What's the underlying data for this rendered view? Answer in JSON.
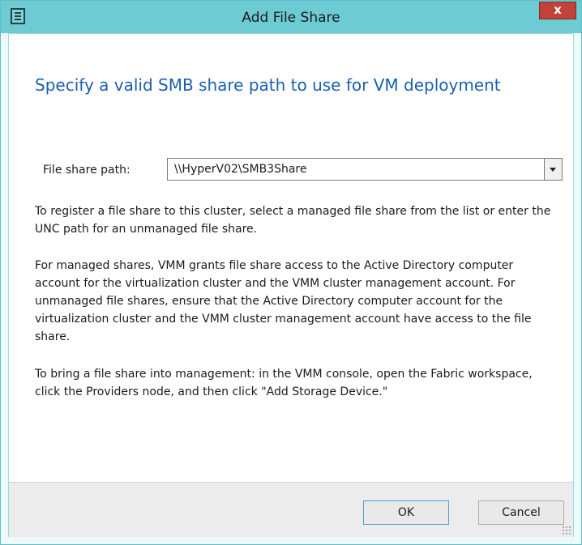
{
  "window": {
    "title": "Add File Share",
    "close_glyph": "x"
  },
  "dialog": {
    "heading": "Specify a valid SMB share path to use for VM deployment",
    "file_share_label": "File share path:",
    "file_share_value": "\\\\HyperV02\\SMB3Share",
    "paragraph1": "To register a file share to this cluster, select a managed file share from the list or enter the UNC path for an unmanaged file share.",
    "paragraph2": "For managed shares, VMM grants file share access to the Active Directory computer account for the virtualization cluster and the VMM cluster management account. For unmanaged file shares, ensure that the Active Directory computer account for the virtualization cluster and the VMM cluster management account have access to the file share.",
    "paragraph3": "To bring a file share into management: in the VMM console, open the Fabric workspace, click the Providers node, and then click \"Add Storage Device.\""
  },
  "buttons": {
    "ok": "OK",
    "cancel": "Cancel"
  },
  "colors": {
    "titlebar": "#6ccbd3",
    "heading": "#1a5fb4",
    "close": "#c1423b"
  }
}
